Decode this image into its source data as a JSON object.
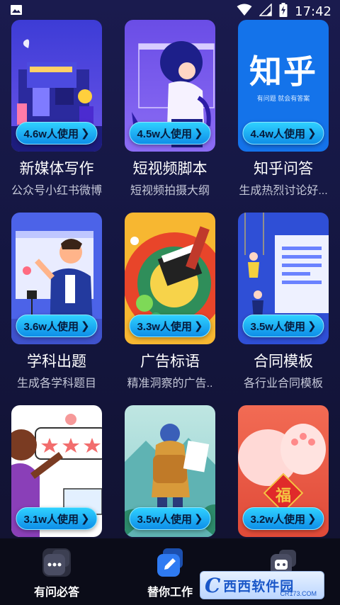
{
  "status_bar": {
    "time": "17:42",
    "icons": [
      "image-icon",
      "wifi-icon",
      "signal-icon",
      "battery-charging-icon"
    ]
  },
  "cards": [
    {
      "title": "新媒体写作",
      "subtitle": "公众号小红书微博",
      "usage": "4.6w人使用",
      "art": "shop-illustration"
    },
    {
      "title": "短视频脚本",
      "subtitle": "短视频拍摄大纲",
      "usage": "4.5w人使用",
      "art": "woman-illustration"
    },
    {
      "title": "知乎问答",
      "subtitle": "生成热烈讨论好...",
      "usage": "4.4w人使用",
      "art": "zhihu-logo",
      "logo_text": "知乎",
      "logo_tagline": "有问题 就会有答案"
    },
    {
      "title": "学科出题",
      "subtitle": "生成各学科题目",
      "usage": "3.6w人使用",
      "art": "vlogger-illustration"
    },
    {
      "title": "广告标语",
      "subtitle": "精准洞察的广告..",
      "usage": "3.3w人使用",
      "art": "clapper-illustration"
    },
    {
      "title": "合同模板",
      "subtitle": "各行业合同模板",
      "usage": "3.5w人使用",
      "art": "contract-illustration"
    },
    {
      "title": "",
      "subtitle": "",
      "usage": "3.1w人使用",
      "art": "review-stars-illustration"
    },
    {
      "title": "",
      "subtitle": "",
      "usage": "3.5w人使用",
      "art": "traveler-illustration"
    },
    {
      "title": "",
      "subtitle": "",
      "usage": "3.2w人使用",
      "art": "fortune-illustration",
      "badge_text": "福"
    }
  ],
  "tabs": [
    {
      "label": "有问必答",
      "icon": "chat-dots-icon",
      "active": false
    },
    {
      "label": "替你工作",
      "icon": "pen-icon",
      "active": true
    },
    {
      "label": "",
      "icon": "robot-icon",
      "active": false
    }
  ],
  "watermark": {
    "logo": "C",
    "text": "西西软件园",
    "small": "CR173.COM"
  },
  "colors": {
    "background": "#151741",
    "pill": "#1aa8f2",
    "pill_text": "#061a3a",
    "subtitle": "#c5c8d8"
  }
}
